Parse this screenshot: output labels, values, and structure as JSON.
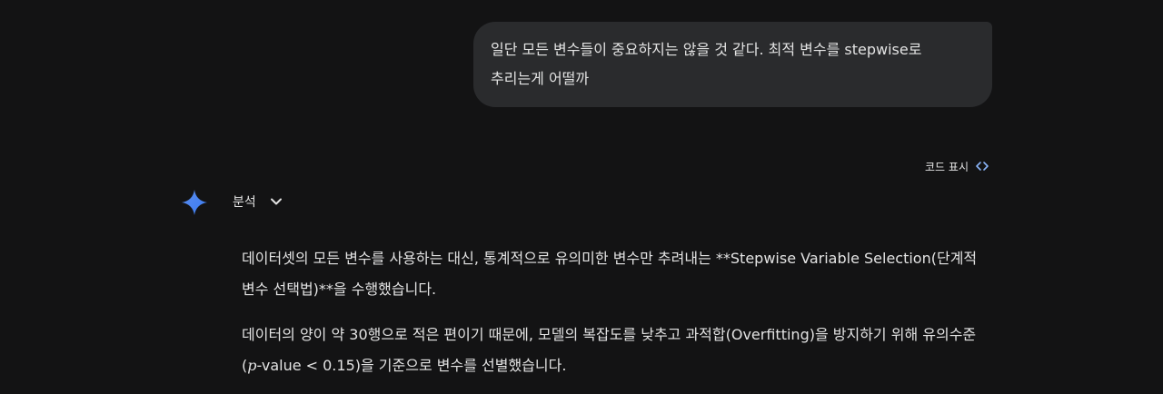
{
  "user_message": {
    "line1": "일단 모든 변수들이 중요하지는 않을 것 같다. 최적 변수를 stepwise로",
    "line2": "추리는게 어떨까"
  },
  "toolbar": {
    "show_code_label": "코드 표시"
  },
  "response": {
    "analysis_label": "분석",
    "para1": "데이터셋의 모든 변수를 사용하는 대신, 통계적으로 유의미한 변수만 추려내는 **Stepwise Variable Selection(단계적 변수 선택법)**을 수행했습니다.",
    "para2_before": "데이터의 양이 약 30행으로 적은 편이기 때문에, 모델의 복잡도를 낮추고 과적합(Overfitting)을 방지하기 위해 유의수준(",
    "para2_math": "p",
    "para2_after": "-value < 0.15)을 기준으로 변수를 선별했습니다."
  },
  "colors": {
    "background": "#131314",
    "bubble": "#2a2b2d",
    "text": "#e3e3e3",
    "gemini_blue": "#4285f4"
  },
  "icons": {
    "code": "code-brackets-icon",
    "gemini": "gemini-sparkle-icon",
    "chevron": "chevron-down-icon"
  }
}
